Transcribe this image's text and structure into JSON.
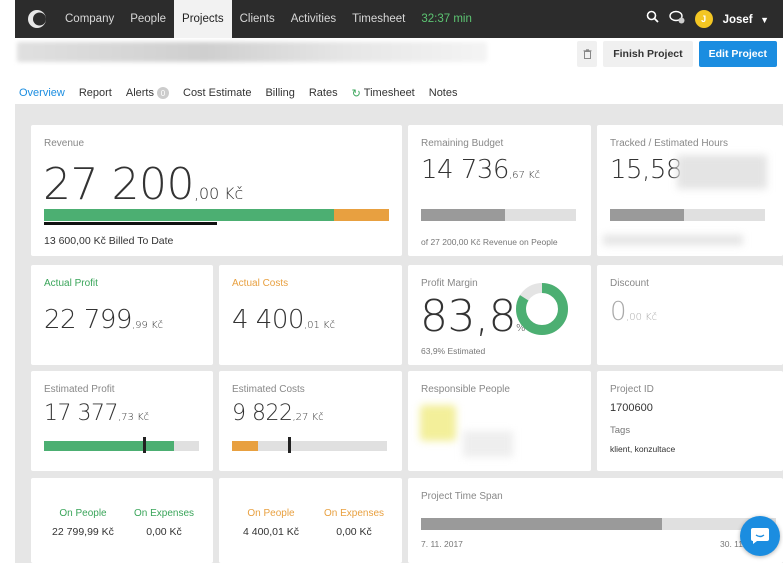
{
  "nav": {
    "items": [
      "Company",
      "People",
      "Projects",
      "Clients",
      "Activities",
      "Timesheet"
    ],
    "active": "Projects",
    "timer": "32:37 min",
    "user": {
      "initial": "J",
      "name": "Josef"
    }
  },
  "header": {
    "finish_label": "Finish Project",
    "edit_label": "Edit Project"
  },
  "tabs": {
    "overview": "Overview",
    "report": "Report",
    "alerts": "Alerts",
    "alerts_count": "0",
    "cost_estimate": "Cost Estimate",
    "billing": "Billing",
    "rates": "Rates",
    "timesheet": "Timesheet",
    "notes": "Notes"
  },
  "revenue": {
    "label": "Revenue",
    "int": "27 200",
    "dec": ",00 Kč",
    "billed": "13 600,00 Kč Billed To Date",
    "billed_fraction": 0.5,
    "cost_fraction": 0.84
  },
  "remaining_budget": {
    "label": "Remaining Budget",
    "int": "14 736",
    "dec": ",67 Kč",
    "sub": "of 27 200,00 Kč Revenue on People",
    "fraction": 0.54
  },
  "tracked_hours": {
    "label": "Tracked / Estimated Hours",
    "value": "15,58",
    "fraction": 0.48
  },
  "actual_profit": {
    "label": "Actual Profit",
    "int": "22 799",
    "dec": ",99 Kč"
  },
  "actual_costs": {
    "label": "Actual Costs",
    "int": "4 400",
    "dec": ",01 Kč"
  },
  "profit_margin": {
    "label": "Profit Margin",
    "int": "83,8",
    "dec": "%",
    "sub": "63,9% Estimated",
    "fraction": 0.838
  },
  "discount": {
    "label": "Discount",
    "int": "0",
    "dec": ",00 Kč"
  },
  "estimated_profit": {
    "label": "Estimated Profit",
    "int": "17 377",
    "dec": ",73 Kč",
    "fraction": 0.84,
    "marker": 0.64
  },
  "estimated_costs": {
    "label": "Estimated Costs",
    "int": "9 822",
    "dec": ",27 Kč",
    "fraction": 0.17,
    "marker": 0.36
  },
  "responsible_people": {
    "label": "Responsible People"
  },
  "project": {
    "id_label": "Project ID",
    "id": "1700600",
    "tags_label": "Tags",
    "tags": "klient, konzultace"
  },
  "people_box": {
    "on_people_label": "On People",
    "on_people_value": "22 799,99 Kč",
    "on_expenses_label": "On Expenses",
    "on_expenses_value": "0,00 Kč"
  },
  "costs_box": {
    "on_people_label": "On People",
    "on_people_value": "4 400,01 Kč",
    "on_expenses_label": "On Expenses",
    "on_expenses_value": "0,00 Kč"
  },
  "time_span": {
    "label": "Project Time Span",
    "start": "7. 11. 2017",
    "end": "30. 11",
    "fraction": 0.68
  },
  "colors": {
    "green": "#4caf72",
    "orange": "#e8a040",
    "gray_bar": "#9a9a9a",
    "track": "#e0e0e0",
    "accent": "#1b8de0"
  }
}
